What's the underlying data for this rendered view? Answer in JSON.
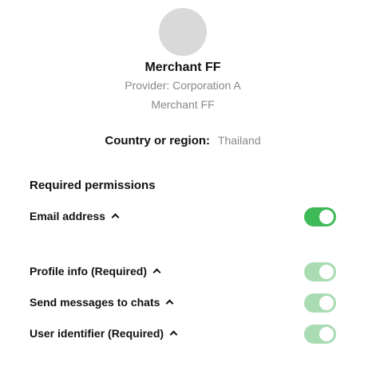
{
  "merchant": {
    "name": "Merchant FF",
    "provider": "Provider: Corporation A",
    "sub_name": "Merchant FF"
  },
  "country": {
    "label": "Country or region:",
    "value": "Thailand"
  },
  "permissions": {
    "title": "Required permissions",
    "items": [
      {
        "label": "Email address",
        "enabled": true,
        "editable": true
      },
      {
        "label": "Profile info (Required)",
        "enabled": true,
        "editable": false
      },
      {
        "label": "Send messages to chats",
        "enabled": true,
        "editable": false
      },
      {
        "label": "User identifier (Required)",
        "enabled": true,
        "editable": false
      }
    ]
  },
  "icons": {
    "expand": "chevron-up-icon"
  },
  "colors": {
    "toggle_on": "#3fba58",
    "toggle_on_disabled": "#a9dcb3",
    "avatar_placeholder": "#d9d9d9",
    "secondary_text": "#888888"
  }
}
